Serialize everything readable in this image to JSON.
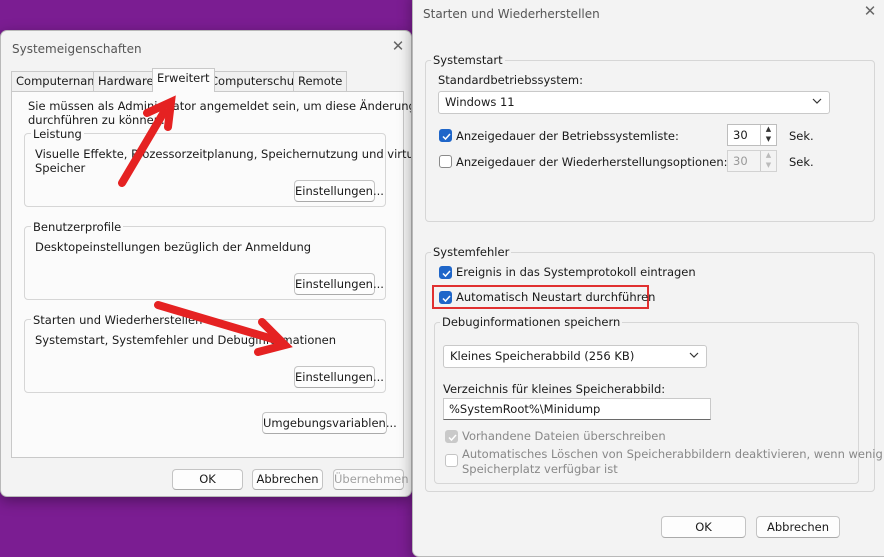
{
  "left_window": {
    "title": "Systemeigenschaften",
    "tabs": [
      "Computername",
      "Hardware",
      "Erweitert",
      "Computerschutz",
      "Remote"
    ],
    "active_tab": "Erweitert",
    "admin_note_1": "Sie müssen als Administrator angemeldet sein, um diese Änderungen",
    "admin_note_2": "durchführen zu können.",
    "performance": {
      "label": "Leistung",
      "desc_1": "Visuelle Effekte, Prozessorzeitplanung, Speichernutzung und virtueller",
      "desc_2": "Speicher",
      "button": "Einstellungen..."
    },
    "profiles": {
      "label": "Benutzerprofile",
      "desc": "Desktopeinstellungen bezüglich der Anmeldung",
      "button": "Einstellungen..."
    },
    "startup": {
      "label": "Starten und Wiederherstellen",
      "desc": "Systemstart, Systemfehler und Debuginformationen",
      "button": "Einstellungen..."
    },
    "env_button": "Umgebungsvariablen...",
    "ok": "OK",
    "cancel": "Abbrechen",
    "apply": "Übernehmen"
  },
  "right_window": {
    "title": "Starten und Wiederherstellen",
    "systemstart": {
      "label": "Systemstart",
      "default_os_label": "Standardbetriebssystem:",
      "default_os_value": "Windows 11",
      "os_list_label": "Anzeigedauer der Betriebssystemliste:",
      "os_list_checked": true,
      "os_list_value": "30",
      "os_list_unit": "Sek.",
      "recovery_label": "Anzeigedauer der Wiederherstellungsoptionen:",
      "recovery_checked": false,
      "recovery_value": "30",
      "recovery_unit": "Sek."
    },
    "systemfehler": {
      "label": "Systemfehler",
      "event_log_label": "Ereignis in das Systemprotokoll eintragen",
      "event_log_checked": true,
      "auto_restart_label": "Automatisch Neustart durchführen",
      "auto_restart_checked": true,
      "debug_label": "Debuginformationen speichern",
      "debug_value": "Kleines Speicherabbild (256 KB)",
      "dir_label": "Verzeichnis für kleines Speicherabbild:",
      "dir_value": "%SystemRoot%\\Minidump",
      "overwrite_label": "Vorhandene Dateien überschreiben",
      "autodelete_label_1": "Automatisches Löschen von Speicherabbildern deaktivieren, wenn wenig",
      "autodelete_label_2": "Speicherplatz verfügbar ist"
    },
    "ok": "OK",
    "cancel": "Abbrechen"
  },
  "colors": {
    "background": "#7b1d92",
    "accent": "#1f66c9",
    "highlight": "#e03030",
    "arrow": "#e52222"
  }
}
